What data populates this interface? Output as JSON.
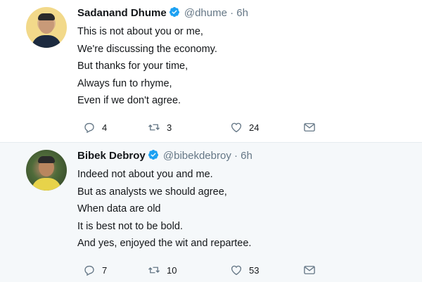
{
  "tweets": [
    {
      "author_name": "Sadanand Dhume",
      "handle": "@dhume",
      "separator": "·",
      "time": "6h",
      "lines": [
        "This is not about you or me,",
        "We're discussing the economy.",
        "But thanks for your time,",
        "Always fun to rhyme,",
        "Even if we don't agree."
      ],
      "replies": "4",
      "retweets": "3",
      "likes": "24"
    },
    {
      "author_name": "Bibek Debroy",
      "handle": "@bibekdebroy",
      "separator": "·",
      "time": "6h",
      "lines": [
        "Indeed not about you and me.",
        "But as analysts we should agree,",
        "When data are old",
        "It is best not to be bold.",
        "And yes, enjoyed the wit and repartee."
      ],
      "replies": "7",
      "retweets": "10",
      "likes": "53"
    }
  ],
  "colors": {
    "verified": "#1da1f2",
    "thread_line": "#c7dcec",
    "secondary_text": "#657786"
  },
  "icons": {
    "reply": "reply-icon",
    "retweet": "retweet-icon",
    "like": "heart-icon",
    "dm": "envelope-icon",
    "verified": "verified-badge-icon"
  }
}
